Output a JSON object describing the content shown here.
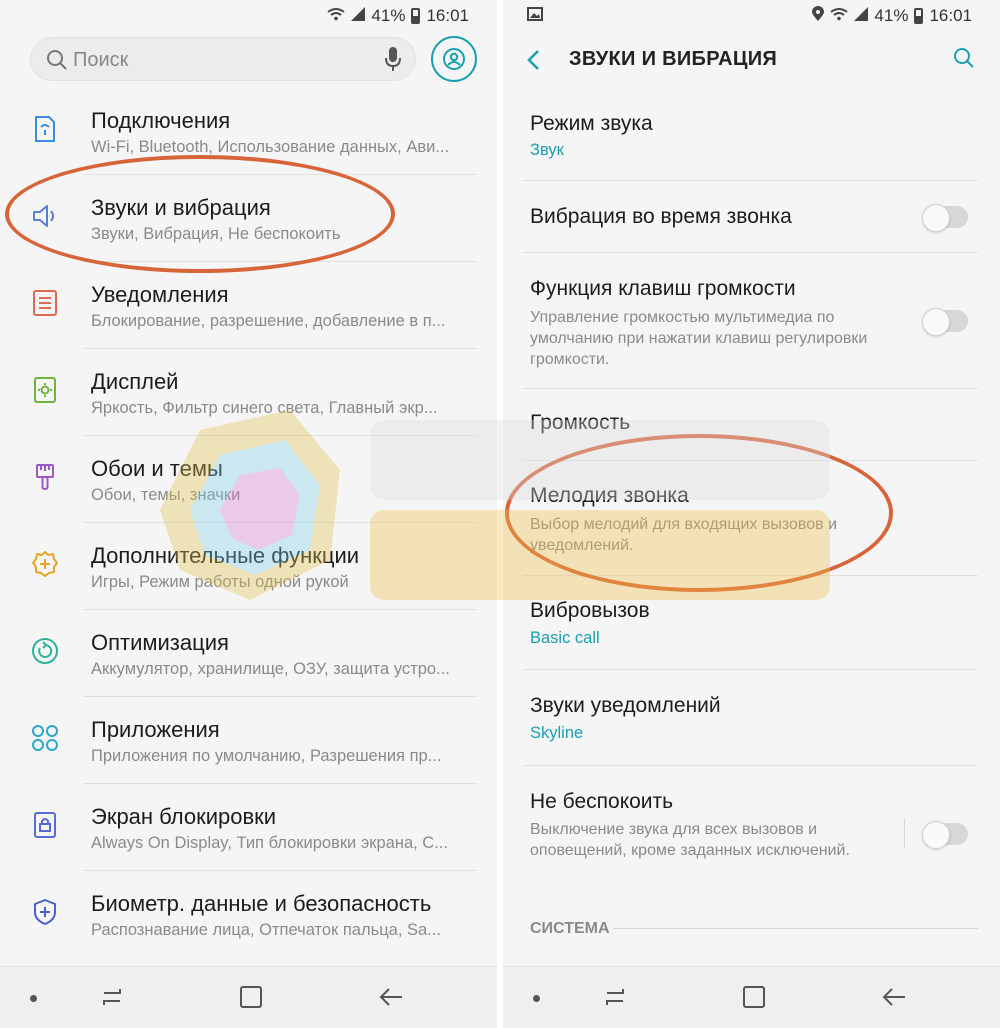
{
  "status": {
    "battery_left": "41%",
    "time_left": "16:01",
    "battery_right": "41%",
    "time_right": "16:01"
  },
  "left": {
    "search_placeholder": "Поиск",
    "items": [
      {
        "icon": "connections-icon",
        "title": "Подключения",
        "subtitle": "Wi-Fi, Bluetooth, Использование данных, Ави..."
      },
      {
        "icon": "speaker-icon",
        "title": "Звуки и вибрация",
        "subtitle": "Звуки, Вибрация, Не беспокоить"
      },
      {
        "icon": "notifications-icon",
        "title": "Уведомления",
        "subtitle": "Блокирование, разрешение, добавление в п..."
      },
      {
        "icon": "display-icon",
        "title": "Дисплей",
        "subtitle": "Яркость, Фильтр синего света, Главный экр..."
      },
      {
        "icon": "brush-icon",
        "title": "Обои и темы",
        "subtitle": "Обои, темы, значки"
      },
      {
        "icon": "gear-plus-icon",
        "title": "Дополнительные функции",
        "subtitle": "Игры, Режим работы одной рукой"
      },
      {
        "icon": "optimization-icon",
        "title": "Оптимизация",
        "subtitle": "Аккумулятор, хранилище, ОЗУ, защита устро..."
      },
      {
        "icon": "apps-icon",
        "title": "Приложения",
        "subtitle": "Приложения по умолчанию, Разрешения пр..."
      },
      {
        "icon": "lock-icon",
        "title": "Экран блокировки",
        "subtitle": "Always On Display, Тип блокировки экрана, С..."
      },
      {
        "icon": "shield-icon",
        "title": "Биометр. данные и безопасность",
        "subtitle": "Распознавание лица, Отпечаток пальца, Sa..."
      }
    ]
  },
  "right": {
    "title": "ЗВУКИ И ВИБРАЦИЯ",
    "sound_mode": {
      "title": "Режим звука",
      "value": "Звук"
    },
    "vibrate_call": {
      "title": "Вибрация во время звонка"
    },
    "volume_keys": {
      "title": "Функция клавиш громкости",
      "subtitle": "Управление громкостью мультимедиа по умолчанию при нажатии клавиш регулировки громкости."
    },
    "volume": {
      "title": "Громкость"
    },
    "ringtone": {
      "title": "Мелодия звонка",
      "subtitle": "Выбор мелодий для входящих вызовов и уведомлений."
    },
    "vibration_pattern": {
      "title": "Вибровызов",
      "value": "Basic call"
    },
    "notification_sounds": {
      "title": "Звуки уведомлений",
      "value": "Skyline"
    },
    "dnd": {
      "title": "Не беспокоить",
      "subtitle": "Выключение звука для всех вызовов и оповещений, кроме заданных исключений."
    },
    "section": "СИСТЕМА"
  },
  "colors": {
    "accent": "#1a9fb1",
    "annotation": "#d8643a"
  }
}
